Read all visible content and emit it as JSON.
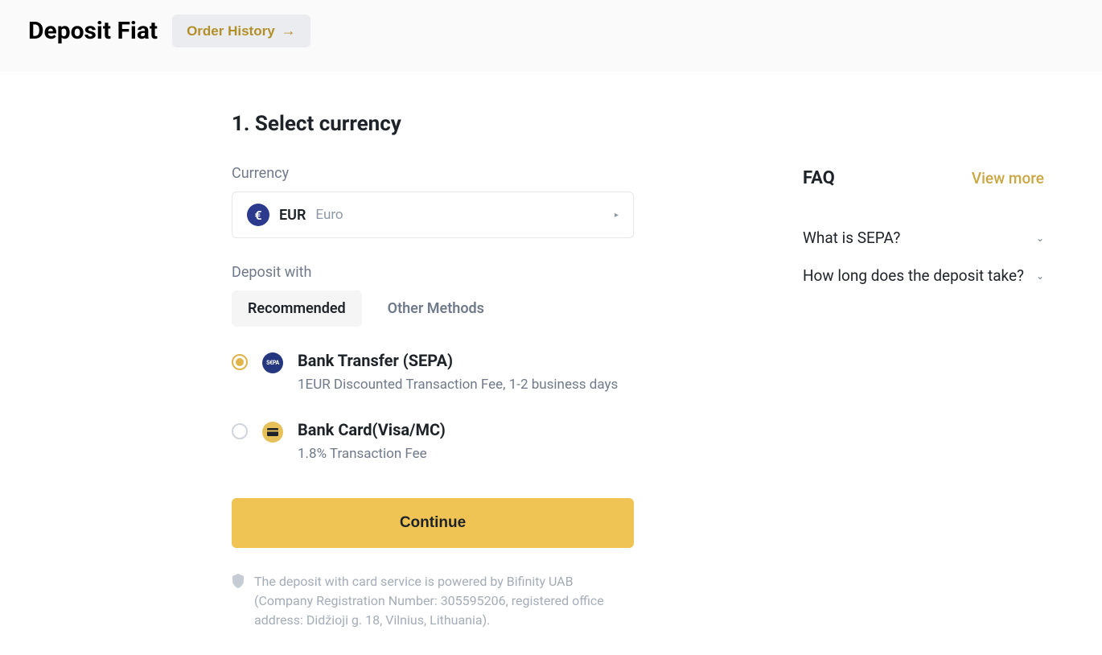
{
  "header": {
    "title": "Deposit Fiat",
    "order_history_label": "Order History"
  },
  "step": {
    "title": "1. Select currency",
    "currency_label": "Currency",
    "currency_code": "EUR",
    "currency_name": "Euro",
    "currency_symbol": "€",
    "deposit_with_label": "Deposit with",
    "tabs": {
      "recommended": "Recommended",
      "other": "Other Methods"
    },
    "methods": [
      {
        "title": "Bank Transfer (SEPA)",
        "desc": "1EUR Discounted Transaction Fee, 1-2 business days",
        "selected": true,
        "icon": "sepa"
      },
      {
        "title": "Bank Card(Visa/MC)",
        "desc": "1.8% Transaction Fee",
        "selected": false,
        "icon": "card"
      }
    ],
    "continue_label": "Continue",
    "disclaimer": "The deposit with card service is powered by Bifinity UAB (Company Registration Number: 305595206, registered office address: Didžioji g. 18, Vilnius, Lithuania)."
  },
  "faq": {
    "title": "FAQ",
    "view_more": "View more",
    "items": [
      "What is SEPA?",
      "How long does the deposit take?"
    ]
  }
}
